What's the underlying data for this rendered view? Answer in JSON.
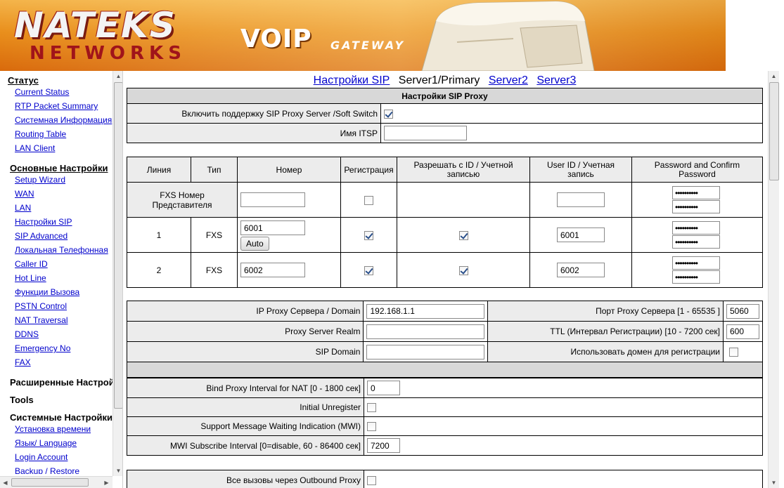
{
  "banner": {
    "logo_top": "NATEKS",
    "logo_bottom": "NETWORKS",
    "product": "VOIP",
    "product_sub": "GATEWAY"
  },
  "nav": {
    "sections": [
      {
        "title": "Статус",
        "items": [
          "Current Status",
          "RTP Packet Summary",
          "Системная Информация",
          "Routing Table",
          "LAN Client"
        ]
      },
      {
        "title": "Основные Настройки",
        "items": [
          "Setup Wizard",
          "WAN",
          "LAN",
          "Настройки SIP",
          "SIP Advanced",
          "Локальная Телефонная",
          "Caller ID",
          "Hot Line",
          "Функции Вызова",
          "PSTN Control",
          "NAT Traversal",
          "DDNS",
          "Emergency No",
          "FAX"
        ]
      },
      {
        "title": "Расширенные Настройки",
        "items": []
      },
      {
        "title": "Tools",
        "items": []
      },
      {
        "title": "Системные Настройки",
        "items": [
          "Установка времени",
          "Язык/ Language",
          "Login Account",
          "Backup / Restore"
        ]
      }
    ]
  },
  "tabs": {
    "settings_sip": "Настройки SIP",
    "server1": "Server1/Primary",
    "server2": "Server2",
    "server3": "Server3"
  },
  "proxy": {
    "header": "Настройки SIP Proxy",
    "enable_label": "Включить поддержку SIP Proxy Server /Soft Switch",
    "enable_checked": true,
    "itsp_label": "Имя ITSP",
    "itsp_value": ""
  },
  "lines": {
    "columns": [
      "Линия",
      "Тип",
      "Номер",
      "Регистрация",
      "Разрешать с ID / Учетной записью",
      "User ID / Учетная запись",
      "Password and Confirm Password"
    ],
    "rep_label": "FXS Номер Представителя",
    "rep_number": "",
    "rep_userid": "",
    "password_mask": "••••••••••",
    "auto_label": "Auto",
    "rows": [
      {
        "line": "1",
        "type": "FXS",
        "number": "6001",
        "userid": "6001"
      },
      {
        "line": "2",
        "type": "FXS",
        "number": "6002",
        "userid": "6002"
      }
    ]
  },
  "server": {
    "ip_label": "IP Proxy Сервера / Domain",
    "ip_value": "192.168.1.1",
    "port_label": "Порт Proxy Сервера [1 - 65535 ]",
    "port_value": "5060",
    "realm_label": "Proxy Server Realm",
    "realm_value": "",
    "ttl_label": "TTL (Интервал Регистрации) [10 - 7200 сек]",
    "ttl_value": "600",
    "domain_label": "SIP Domain",
    "domain_value": "",
    "use_domain_label": "Использовать домен для регистрации"
  },
  "advanced": {
    "bind_label": "Bind Proxy Interval for NAT [0 - 1800 сек]",
    "bind_value": "0",
    "unregister_label": "Initial Unregister",
    "mwi_label": "Support Message Waiting Indication (MWI)",
    "mwi_interval_label": "MWI Subscribe Interval [0=disable, 60 - 86400 сек]",
    "mwi_interval_value": "7200"
  },
  "outbound": {
    "label": "Все вызовы через Outbound Proxy"
  }
}
